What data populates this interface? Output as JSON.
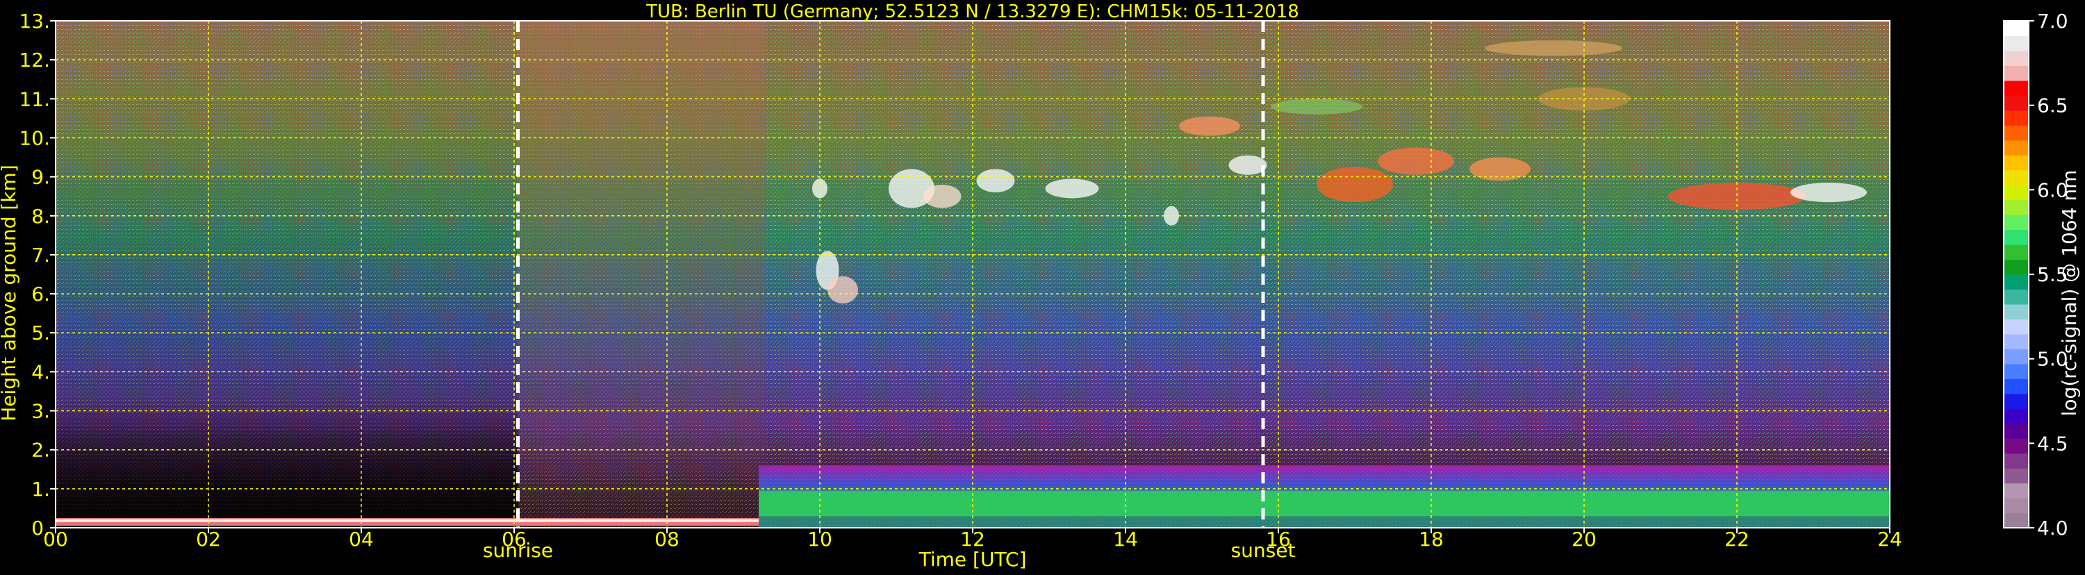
{
  "chart_data": {
    "type": "heatmap",
    "title": "TUB: Berlin TU (Germany; 52.5123 N / 13.3279 E):    CHM15k: 05-11-2018",
    "xlabel": "Time [UTC]",
    "ylabel": "Height above ground [km]",
    "x_ticks": [
      "00",
      "02",
      "04",
      "06",
      "08",
      "10",
      "12",
      "14",
      "16",
      "18",
      "20",
      "22",
      "24"
    ],
    "y_ticks": [
      "0.",
      "1.",
      "2.",
      "3.",
      "4.",
      "5.",
      "6.",
      "7.",
      "8.",
      "9.",
      "10.",
      "11.",
      "12.",
      "13."
    ],
    "xlim": [
      0,
      24
    ],
    "ylim": [
      0,
      13
    ],
    "grid": true,
    "events": [
      {
        "label": "sunrise",
        "time": 6.05
      },
      {
        "label": "sunset",
        "time": 15.8
      }
    ],
    "colorbar": {
      "label": "log(rc-signal) @ 1064 nm",
      "range": [
        4.0,
        7.0
      ],
      "ticks": [
        "4.0",
        "4.5",
        "5.0",
        "5.5",
        "6.0",
        "6.5",
        "7.0"
      ],
      "colors": [
        "#9a7f99",
        "#a98aa4",
        "#b496b0",
        "#8e5a8f",
        "#84388c",
        "#750c85",
        "#5a0099",
        "#3a00c8",
        "#1a1ae8",
        "#2050ff",
        "#4a7cff",
        "#7a9eff",
        "#a4b8ff",
        "#c8d2ff",
        "#90cfd8",
        "#39b7a0",
        "#00a070",
        "#10a020",
        "#30c030",
        "#30e070",
        "#60f060",
        "#a0f030",
        "#d0f000",
        "#f0e000",
        "#ffc000",
        "#ff9000",
        "#ff6000",
        "#ff3000",
        "#f01010",
        "#ff0000",
        "#f0b0b0",
        "#f0d0d0",
        "#eaeaea",
        "#ffffff"
      ]
    }
  }
}
